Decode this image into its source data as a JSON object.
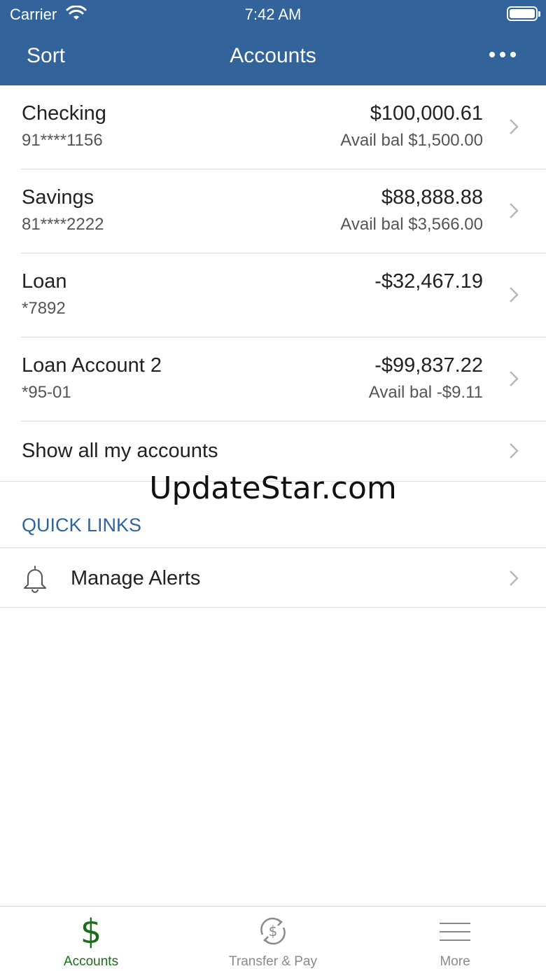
{
  "status_bar": {
    "carrier": "Carrier",
    "time": "7:42 AM"
  },
  "nav": {
    "left_label": "Sort",
    "title": "Accounts",
    "right_icon": "more-dots-icon"
  },
  "accounts": [
    {
      "name": "Checking",
      "number": "91****1156",
      "balance": "$100,000.61",
      "available": "Avail bal $1,500.00"
    },
    {
      "name": "Savings",
      "number": "81****2222",
      "balance": "$88,888.88",
      "available": "Avail bal $3,566.00"
    },
    {
      "name": "Loan",
      "number": "*7892",
      "balance": "-$32,467.19",
      "available": ""
    },
    {
      "name": "Loan Account 2",
      "number": "*95-01",
      "balance": "-$99,837.22",
      "available": "Avail bal -$9.11"
    }
  ],
  "show_all_label": "Show all my accounts",
  "watermark": "UpdateStar.com",
  "quick_links": {
    "header": "QUICK LINKS",
    "items": [
      {
        "label": "Manage Alerts",
        "icon": "bell-icon"
      }
    ]
  },
  "tabbar": {
    "tabs": [
      {
        "label": "Accounts",
        "icon": "dollar-icon",
        "active": true
      },
      {
        "label": "Transfer & Pay",
        "icon": "transfer-dollar-icon",
        "active": false
      },
      {
        "label": "More",
        "icon": "hamburger-icon",
        "active": false
      }
    ]
  },
  "colors": {
    "header_bg": "#32639a",
    "accent_green": "#1d6b1d",
    "link_blue": "#32639a"
  }
}
